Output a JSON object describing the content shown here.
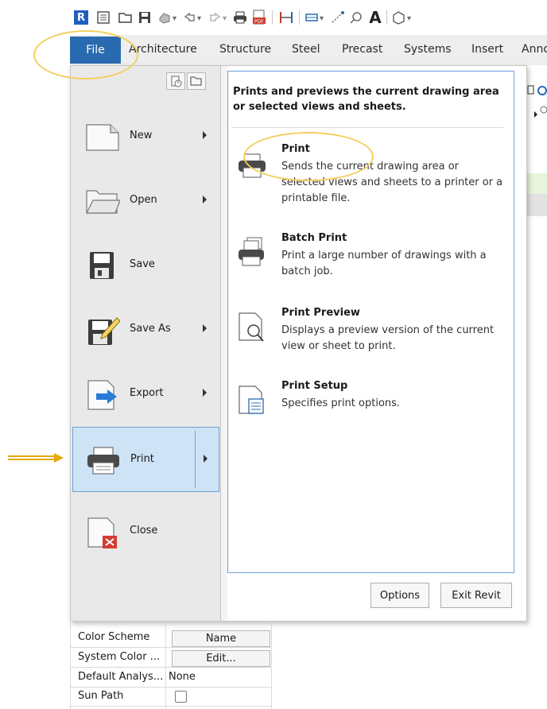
{
  "quick_access_toolbar": {
    "app_letter": "R",
    "items": [
      "revit-logo-icon",
      "properties-icon",
      "open-icon",
      "save-icon",
      "sync-icon",
      "undo-icon",
      "redo-icon",
      "print-icon",
      "export-pdf-icon",
      "measure-icon",
      "dimension-icon",
      "spot-icon",
      "tag-icon",
      "text-icon",
      "3d-view-icon"
    ]
  },
  "ribbon_tabs": [
    "File",
    "Architecture",
    "Structure",
    "Steel",
    "Precast",
    "Systems",
    "Insert",
    "Anno"
  ],
  "app_menu": {
    "left_items": [
      {
        "label": "New",
        "icon": "new-document-icon",
        "has_submenu": true
      },
      {
        "label": "Open",
        "icon": "open-folder-icon",
        "has_submenu": true
      },
      {
        "label": "Save",
        "icon": "floppy-disk-icon",
        "has_submenu": false
      },
      {
        "label": "Save As",
        "icon": "save-as-icon",
        "has_submenu": true
      },
      {
        "label": "Export",
        "icon": "export-icon",
        "has_submenu": true
      },
      {
        "label": "Print",
        "icon": "printer-icon",
        "has_submenu": true,
        "active": true
      },
      {
        "label": "Close",
        "icon": "close-document-icon",
        "has_submenu": false
      }
    ],
    "flyout": {
      "header": "Prints and previews the current drawing area or selected views and sheets.",
      "items": [
        {
          "title": "Print",
          "desc": "Sends the current drawing area or selected views and sheets to a printer or a printable file.",
          "icon": "printer-icon"
        },
        {
          "title": "Batch Print",
          "desc": "Print a large number of drawings with a batch job.",
          "icon": "batch-print-icon"
        },
        {
          "title": "Print Preview",
          "desc": "Displays a preview version of the current view or sheet to print.",
          "icon": "print-preview-icon"
        },
        {
          "title": "Print Setup",
          "desc": "Specifies print options.",
          "icon": "print-setup-icon"
        }
      ]
    },
    "buttons": {
      "options": "Options",
      "exit": "Exit Revit"
    }
  },
  "properties": [
    {
      "name": "Color Scheme",
      "value": "Name",
      "kind": "button"
    },
    {
      "name": "System Color ...",
      "value": "Edit...",
      "kind": "button"
    },
    {
      "name": "Default Analys...",
      "value": "None",
      "kind": "text"
    },
    {
      "name": "Sun Path",
      "value": "",
      "kind": "checkbox"
    }
  ],
  "colors": {
    "file_tab": "#2a6ab0",
    "active_item_bg": "#cfe3f6",
    "flyout_border": "#6aa0d8",
    "highlight": "#f3cf5d",
    "arrow": "#e5a900"
  }
}
